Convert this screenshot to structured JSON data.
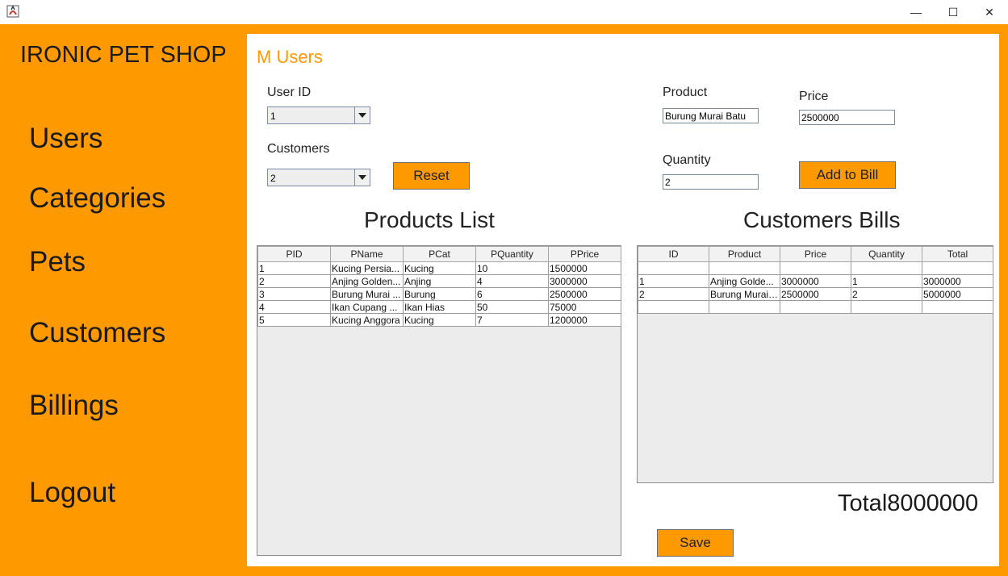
{
  "window": {
    "min_glyph": "—",
    "max_glyph": "☐",
    "close_glyph": "✕"
  },
  "sidebar": {
    "brand": "IRONIC PET SHOP",
    "items": [
      "Users",
      "Categories",
      "Pets",
      "Customers",
      "Billings",
      "Logout"
    ]
  },
  "main": {
    "title": "M Users",
    "user_id_label": "User ID",
    "user_id_value": "1",
    "customers_label": "Customers",
    "customers_value": "2",
    "reset_label": "Reset",
    "product_label": "Product",
    "product_value": "Burung Murai Batu",
    "price_label": "Price",
    "price_value": "2500000",
    "quantity_label": "Quantity",
    "quantity_value": "2",
    "add_to_bill_label": "Add to Bill",
    "products_heading": "Products List",
    "bills_heading": "Customers Bills",
    "total_text": "Total8000000",
    "save_label": "Save"
  },
  "products_table": {
    "headers": [
      "PID",
      "PName",
      "PCat",
      "PQuantity",
      "PPrice"
    ],
    "rows": [
      [
        "1",
        "Kucing Persia...",
        "Kucing",
        "10",
        "1500000"
      ],
      [
        "2",
        "Anjing Golden...",
        "Anjing",
        "4",
        "3000000"
      ],
      [
        "3",
        "Burung Murai ...",
        "Burung",
        "6",
        "2500000"
      ],
      [
        "4",
        "Ikan Cupang ...",
        "Ikan Hias",
        "50",
        "75000"
      ],
      [
        "5",
        "Kucing Anggora",
        "Kucing",
        "7",
        "1200000"
      ]
    ]
  },
  "bills_table": {
    "headers": [
      "ID",
      "Product",
      "Price",
      "Quantity",
      "Total"
    ],
    "rows": [
      [
        "",
        "",
        "",
        "",
        ""
      ],
      [
        "1",
        "Anjing Golde...",
        "3000000",
        "1",
        "3000000"
      ],
      [
        "2",
        "Burung Murai ...",
        "2500000",
        "2",
        "5000000"
      ],
      [
        "",
        "",
        "",
        "",
        ""
      ]
    ]
  },
  "colors": {
    "accent": "#ff9900",
    "panel": "#ffffff",
    "table_bg": "#ececec"
  }
}
